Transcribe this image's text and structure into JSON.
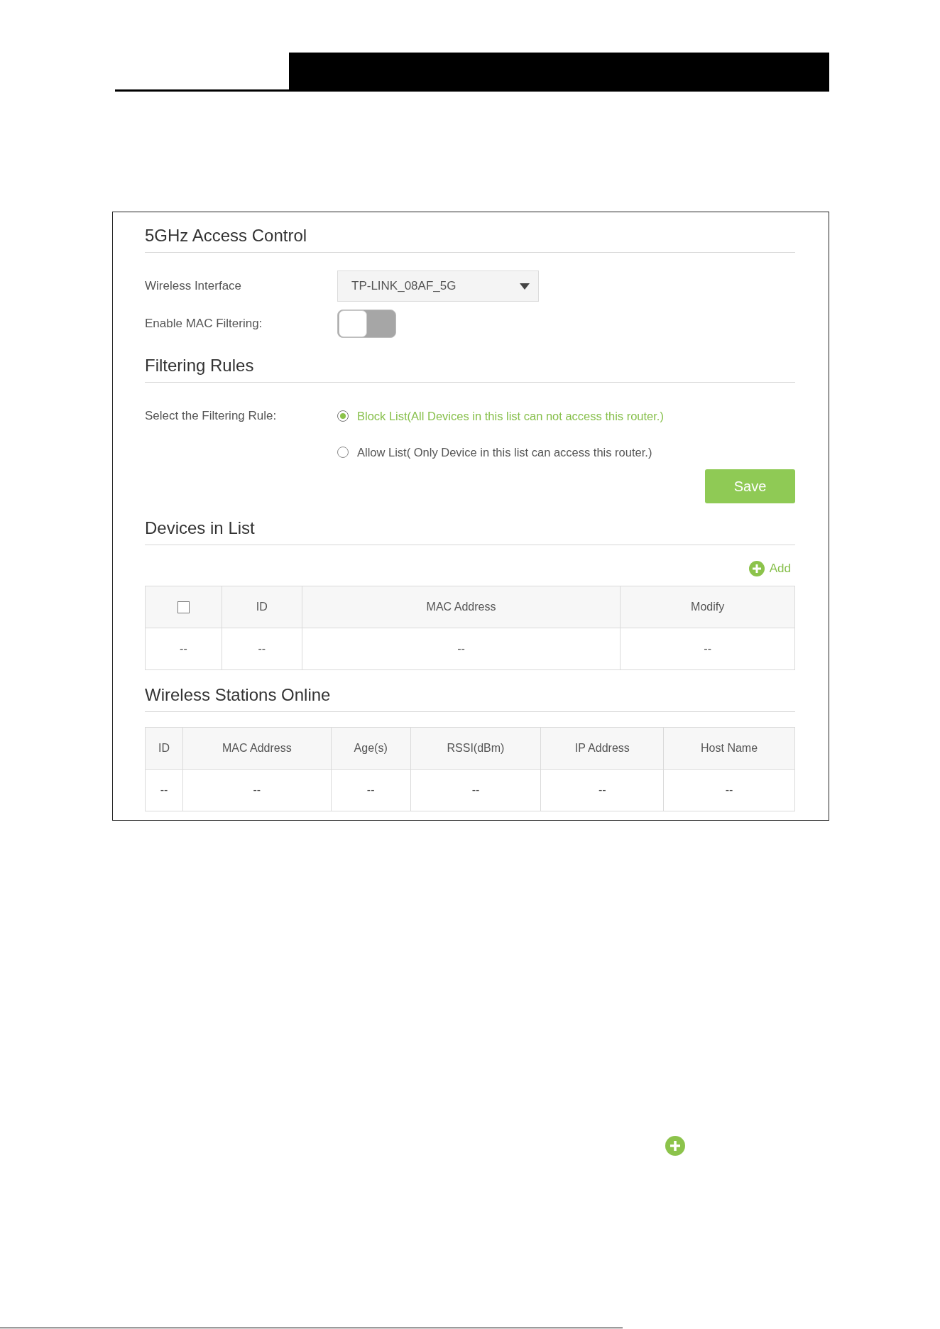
{
  "access_control": {
    "title": "5GHz Access Control",
    "wireless_interface": {
      "label": "Wireless Interface",
      "value": "TP-LINK_08AF_5G"
    },
    "mac_filtering": {
      "label": "Enable MAC Filtering:",
      "on": false
    }
  },
  "filtering_rules": {
    "title": "Filtering Rules",
    "label": "Select the Filtering Rule:",
    "options": [
      {
        "label": "Block List(All Devices in this list can not access this router.)",
        "selected": true
      },
      {
        "label": "Allow List( Only Device in this list can access this router.)",
        "selected": false
      }
    ],
    "save_button": "Save"
  },
  "devices_in_list": {
    "title": "Devices in List",
    "add_button": "Add",
    "table": {
      "select_all": {
        "checked": false
      },
      "columns": [
        "",
        "ID",
        "MAC Address",
        "Modify"
      ],
      "rows": [
        [
          "--",
          "--",
          "--",
          "--"
        ]
      ]
    }
  },
  "wireless_stations_online": {
    "title": "Wireless Stations Online",
    "table": {
      "columns": [
        "ID",
        "MAC Address",
        "Age(s)",
        "RSSI(dBm)",
        "IP Address",
        "Host Name"
      ],
      "rows": [
        [
          "--",
          "--",
          "--",
          "--",
          "--",
          "--"
        ]
      ]
    }
  }
}
